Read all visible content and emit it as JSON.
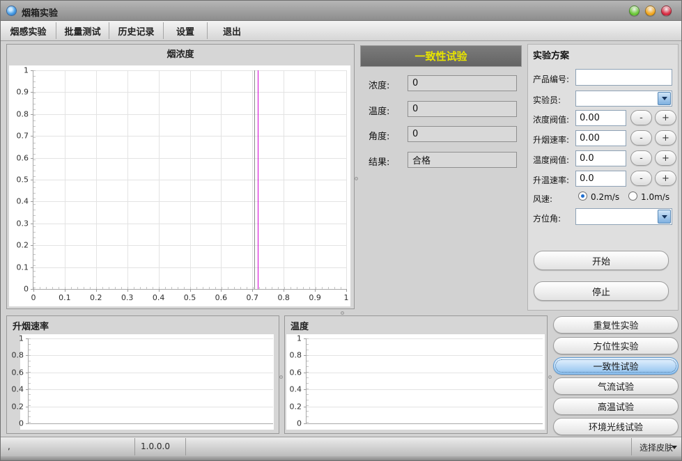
{
  "window": {
    "title": "烟箱实验",
    "version": "1.0.0.0",
    "statusbar_left": ",",
    "skin_label": "选择皮肤",
    "controls": [
      {
        "name": "minimize",
        "color": "#6cc93a"
      },
      {
        "name": "maximize",
        "color": "#f2a71f"
      },
      {
        "name": "close",
        "color": "#d92e44"
      }
    ]
  },
  "menu": {
    "items": [
      {
        "label": "烟感实验"
      },
      {
        "label": "批量测试"
      },
      {
        "label": "历史记录"
      },
      {
        "label": "设置"
      },
      {
        "label": "退出"
      }
    ]
  },
  "consistency": {
    "title": "一致性试验",
    "title_color": "#e8e400",
    "rows": [
      {
        "label": "浓度:",
        "value": "0"
      },
      {
        "label": "温度:",
        "value": "0"
      },
      {
        "label": "角度:",
        "value": "0"
      },
      {
        "label": "结果:",
        "value": "合格"
      }
    ]
  },
  "plan": {
    "title": "实验方案",
    "product": {
      "label": "产品编号:",
      "value": ""
    },
    "operator": {
      "label": "实验员:",
      "value": ""
    },
    "spinners": [
      {
        "label": "浓度阀值:",
        "value": "0.00"
      },
      {
        "label": "升烟速率:",
        "value": "0.00"
      },
      {
        "label": "温度阀值:",
        "value": "0.0"
      },
      {
        "label": "升温速率:",
        "value": "0.0"
      }
    ],
    "minus": "-",
    "plus": "+",
    "wind": {
      "label": "风速:",
      "options": [
        {
          "label": "0.2m/s",
          "selected": true
        },
        {
          "label": "1.0m/s",
          "selected": false
        }
      ]
    },
    "azimuth": {
      "label": "方位角:",
      "value": ""
    },
    "start": "开始",
    "stop": "停止"
  },
  "test_buttons": [
    {
      "label": "重复性实验",
      "active": false
    },
    {
      "label": "方位性实验",
      "active": false
    },
    {
      "label": "一致性试验",
      "active": true
    },
    {
      "label": "气流试验",
      "active": false
    },
    {
      "label": "高温试验",
      "active": false
    },
    {
      "label": "环境光线试验",
      "active": false
    }
  ],
  "chart_data": [
    {
      "type": "line",
      "title": "烟浓度",
      "xlabel": "",
      "ylabel": "",
      "xlim": [
        0,
        1
      ],
      "ylim": [
        0,
        1
      ],
      "x_ticks": [
        0,
        0.1,
        0.2,
        0.3,
        0.4,
        0.5,
        0.6,
        0.7,
        0.8,
        0.9,
        1
      ],
      "y_ticks": [
        0,
        0.1,
        0.2,
        0.3,
        0.4,
        0.5,
        0.6,
        0.7,
        0.8,
        0.9,
        1
      ],
      "grid": true,
      "legend": false,
      "series": [],
      "markers": [
        {
          "axis": "x",
          "value": 0.705,
          "color": "#8a8a8a"
        },
        {
          "axis": "x",
          "value": 0.718,
          "color": "#d400d4"
        }
      ]
    },
    {
      "type": "line",
      "title": "升烟速率",
      "xlim": [
        0,
        1
      ],
      "ylim": [
        0,
        1
      ],
      "x_ticks": [],
      "y_ticks": [
        0,
        0.2,
        0.4,
        0.6,
        0.8,
        1
      ],
      "grid": true,
      "legend": false,
      "series": [],
      "markers": []
    },
    {
      "type": "line",
      "title": "温度",
      "xlim": [
        0,
        1
      ],
      "ylim": [
        0,
        1
      ],
      "x_ticks": [],
      "y_ticks": [
        0,
        0.2,
        0.4,
        0.6,
        0.8,
        1
      ],
      "grid": true,
      "legend": false,
      "series": [],
      "markers": []
    }
  ]
}
